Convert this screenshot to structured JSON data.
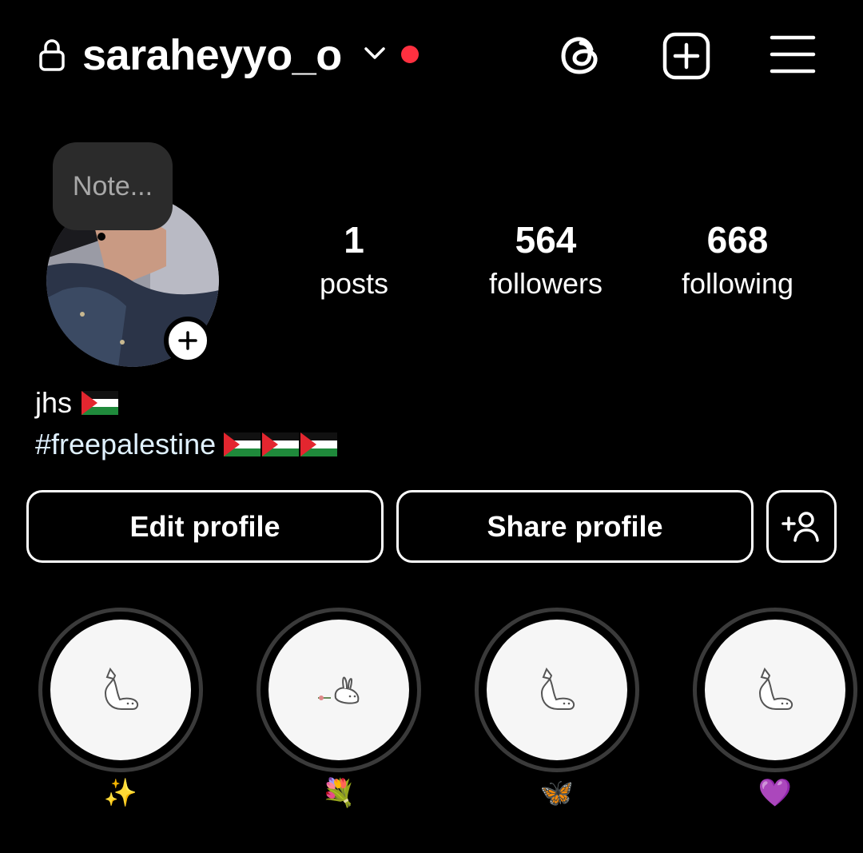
{
  "header": {
    "username": "saraheyyo_o"
  },
  "note": {
    "placeholder": "Note..."
  },
  "stats": {
    "posts": {
      "value": "1",
      "label": "posts"
    },
    "followers": {
      "value": "564",
      "label": "followers"
    },
    "following": {
      "value": "668",
      "label": "following"
    }
  },
  "bio": {
    "name": "jhs",
    "text": "#freepalestine"
  },
  "buttons": {
    "edit": "Edit profile",
    "share": "Share profile"
  },
  "highlights": [
    {
      "caption": "✨",
      "icon": "cat-doodle-icon"
    },
    {
      "caption": "💐",
      "icon": "rabbit-doodle-icon"
    },
    {
      "caption": "🦋",
      "icon": "cat-doodle-icon"
    },
    {
      "caption": "💜",
      "icon": "cat-doodle-icon"
    }
  ],
  "colors": {
    "background": "#000000",
    "notification_dot": "#ff3040",
    "highlight_ring": "#3a3a3a",
    "hashtag": "#e0f1ff"
  }
}
